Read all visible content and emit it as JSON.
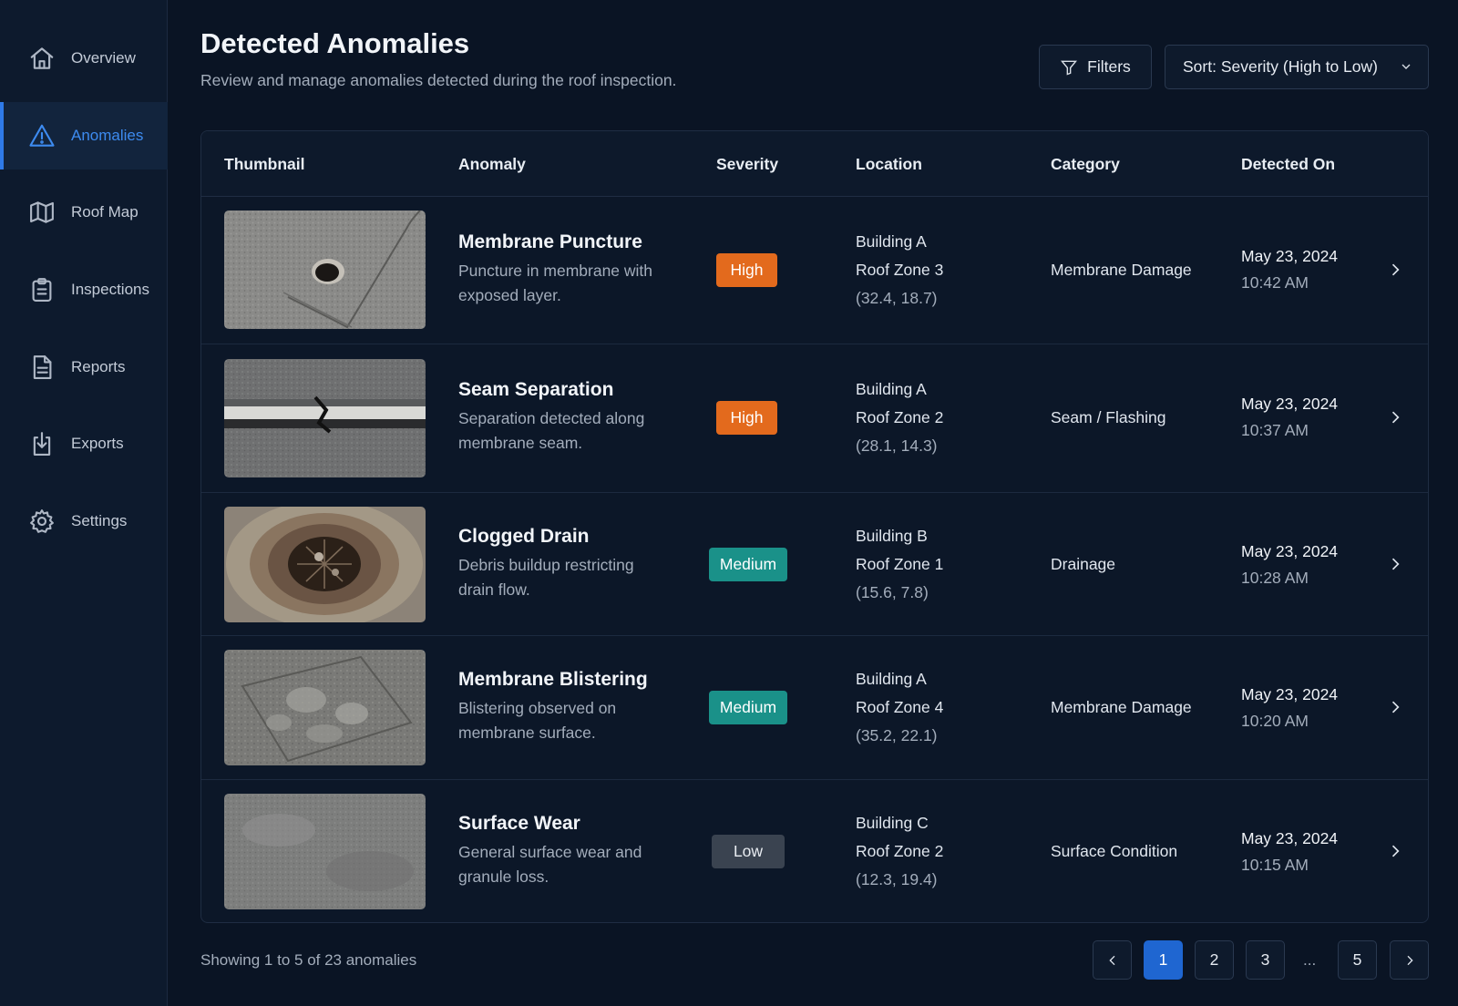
{
  "sidebar": {
    "items": [
      {
        "label": "Overview",
        "icon": "home-icon",
        "active": false
      },
      {
        "label": "Anomalies",
        "icon": "warning-icon",
        "active": true
      },
      {
        "label": "Roof Map",
        "icon": "map-icon",
        "active": false
      },
      {
        "label": "Inspections",
        "icon": "clipboard-icon",
        "active": false
      },
      {
        "label": "Reports",
        "icon": "document-icon",
        "active": false
      },
      {
        "label": "Exports",
        "icon": "export-icon",
        "active": false
      },
      {
        "label": "Settings",
        "icon": "gear-icon",
        "active": false
      }
    ]
  },
  "header": {
    "title": "Detected Anomalies",
    "subtitle": "Review and manage anomalies detected during the roof inspection.",
    "filters_label": "Filters",
    "sort_label": "Sort: Severity (High to Low)"
  },
  "table": {
    "columns": [
      "Thumbnail",
      "Anomaly",
      "Severity",
      "Location",
      "Category",
      "Detected On"
    ],
    "rows": [
      {
        "title": "Membrane Puncture",
        "desc": "Puncture in membrane with exposed layer.",
        "severity": "High",
        "building": "Building A",
        "zone": "Roof Zone 3",
        "coords": "(32.4, 18.7)",
        "category": "Membrane Damage",
        "date": "May 23, 2024",
        "time": "10:42 AM"
      },
      {
        "title": "Seam Separation",
        "desc": "Separation detected along membrane seam.",
        "severity": "High",
        "building": "Building A",
        "zone": "Roof Zone 2",
        "coords": "(28.1, 14.3)",
        "category": "Seam / Flashing",
        "date": "May 23, 2024",
        "time": "10:37 AM"
      },
      {
        "title": "Clogged Drain",
        "desc": "Debris buildup restricting drain flow.",
        "severity": "Medium",
        "building": "Building B",
        "zone": "Roof Zone 1",
        "coords": "(15.6, 7.8)",
        "category": "Drainage",
        "date": "May 23, 2024",
        "time": "10:28 AM"
      },
      {
        "title": "Membrane Blistering",
        "desc": "Blistering observed on membrane surface.",
        "severity": "Medium",
        "building": "Building A",
        "zone": "Roof Zone 4",
        "coords": "(35.2, 22.1)",
        "category": "Membrane Damage",
        "date": "May 23, 2024",
        "time": "10:20 AM"
      },
      {
        "title": "Surface Wear",
        "desc": "General surface wear and granule loss.",
        "severity": "Low",
        "building": "Building C",
        "zone": "Roof Zone 2",
        "coords": "(12.3, 19.4)",
        "category": "Surface Condition",
        "date": "May 23, 2024",
        "time": "10:15 AM"
      }
    ]
  },
  "footer": {
    "showing": "Showing 1 to 5 of 23 anomalies",
    "pages": [
      "1",
      "2",
      "3",
      "5"
    ],
    "ellipsis": "...",
    "current_page": "1"
  },
  "colors": {
    "accent": "#2f7ae8",
    "high": "#e36a1d",
    "medium": "#1a9189",
    "low": "#3a4350"
  }
}
